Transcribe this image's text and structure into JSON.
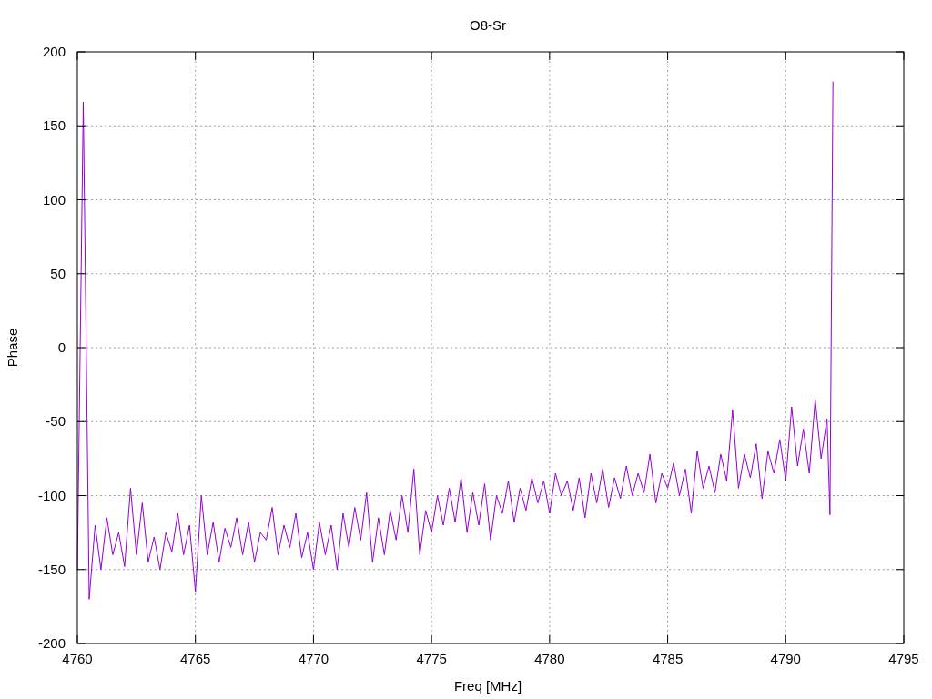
{
  "chart_data": {
    "type": "line",
    "grid": true,
    "title": "O8-Sr",
    "xlabel": "Freq [MHz]",
    "ylabel": "Phase",
    "xlim": [
      4760,
      4795
    ],
    "ylim": [
      -200,
      200
    ],
    "xticks": [
      4760,
      4765,
      4770,
      4775,
      4780,
      4785,
      4790,
      4795
    ],
    "yticks": [
      -200,
      -150,
      -100,
      -50,
      0,
      50,
      100,
      150,
      200
    ],
    "x": [
      4760,
      4760.25,
      4760.5,
      4760.75,
      4761,
      4761.25,
      4761.5,
      4761.75,
      4762,
      4762.25,
      4762.5,
      4762.75,
      4763,
      4763.25,
      4763.5,
      4763.75,
      4764,
      4764.25,
      4764.5,
      4764.75,
      4765,
      4765.25,
      4765.5,
      4765.75,
      4766,
      4766.25,
      4766.5,
      4766.75,
      4767,
      4767.25,
      4767.5,
      4767.75,
      4768,
      4768.25,
      4768.5,
      4768.75,
      4769,
      4769.25,
      4769.5,
      4769.75,
      4770,
      4770.25,
      4770.5,
      4770.75,
      4771,
      4771.25,
      4771.5,
      4771.75,
      4772,
      4772.25,
      4772.5,
      4772.75,
      4773,
      4773.25,
      4773.5,
      4773.75,
      4774,
      4774.25,
      4774.5,
      4774.75,
      4775,
      4775.25,
      4775.5,
      4775.75,
      4776,
      4776.25,
      4776.5,
      4776.75,
      4777,
      4777.25,
      4777.5,
      4777.75,
      4778,
      4778.25,
      4778.5,
      4778.75,
      4779,
      4779.25,
      4779.5,
      4779.75,
      4780,
      4780.25,
      4780.5,
      4780.75,
      4781,
      4781.25,
      4781.5,
      4781.75,
      4782,
      4782.25,
      4782.5,
      4782.75,
      4783,
      4783.25,
      4783.5,
      4783.75,
      4784,
      4784.25,
      4784.5,
      4784.75,
      4785,
      4785.25,
      4785.5,
      4785.75,
      4786,
      4786.25,
      4786.5,
      4786.75,
      4787,
      4787.25,
      4787.5,
      4787.75,
      4788,
      4788.25,
      4788.5,
      4788.75,
      4789,
      4789.25,
      4789.5,
      4789.75,
      4790,
      4790.25,
      4790.5,
      4790.75,
      4791,
      4791.25,
      4791.5,
      4791.75,
      4791.875,
      4792
    ],
    "series": [
      {
        "color": "#9400d3",
        "values": [
          -150,
          166,
          -170,
          -120,
          -150,
          -115,
          -140,
          -125,
          -148,
          -95,
          -140,
          -105,
          -145,
          -128,
          -150,
          -125,
          -138,
          -112,
          -140,
          -120,
          -165,
          -100,
          -140,
          -118,
          -145,
          -122,
          -135,
          -115,
          -140,
          -118,
          -145,
          -125,
          -130,
          -108,
          -140,
          -120,
          -135,
          -112,
          -142,
          -125,
          -150,
          -118,
          -140,
          -120,
          -150,
          -112,
          -135,
          -108,
          -130,
          -98,
          -145,
          -115,
          -140,
          -110,
          -130,
          -100,
          -125,
          -82,
          -140,
          -110,
          -125,
          -100,
          -120,
          -95,
          -118,
          -88,
          -125,
          -98,
          -120,
          -92,
          -130,
          -100,
          -112,
          -90,
          -118,
          -95,
          -110,
          -88,
          -105,
          -90,
          -112,
          -85,
          -100,
          -90,
          -110,
          -88,
          -115,
          -85,
          -105,
          -82,
          -108,
          -88,
          -102,
          -80,
          -100,
          -85,
          -98,
          -72,
          -105,
          -85,
          -95,
          -78,
          -100,
          -82,
          -112,
          -70,
          -95,
          -80,
          -98,
          -72,
          -90,
          -42,
          -95,
          -72,
          -88,
          -65,
          -102,
          -70,
          -85,
          -62,
          -90,
          -40,
          -80,
          -55,
          -85,
          -35,
          -75,
          -48,
          -113,
          180
        ]
      }
    ]
  }
}
